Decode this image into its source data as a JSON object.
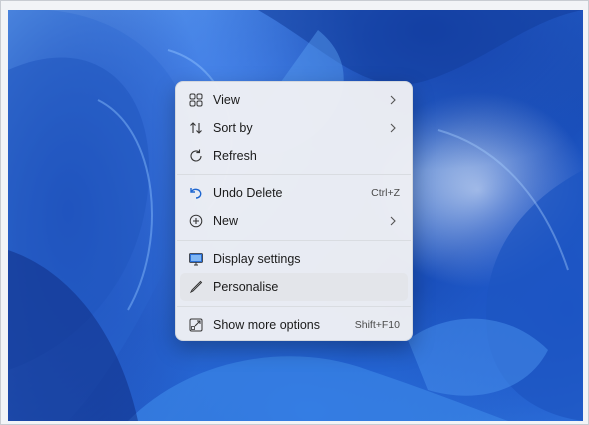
{
  "menu": {
    "items": [
      {
        "label": "View",
        "icon": "grid-icon",
        "submenu": true
      },
      {
        "label": "Sort by",
        "icon": "sort-icon",
        "submenu": true
      },
      {
        "label": "Refresh",
        "icon": "refresh-icon",
        "submenu": false
      },
      {
        "label": "Undo Delete",
        "icon": "undo-icon",
        "shortcut": "Ctrl+Z"
      },
      {
        "label": "New",
        "icon": "plus-circle-icon",
        "submenu": true
      },
      {
        "label": "Display settings",
        "icon": "display-icon"
      },
      {
        "label": "Personalise",
        "icon": "brush-icon",
        "highlighted": true
      },
      {
        "label": "Show more options",
        "icon": "open-external-icon",
        "shortcut": "Shift+F10"
      }
    ]
  },
  "colors": {
    "menu_bg": "#eef0f4",
    "hover_bg": "#e3e5ea",
    "accent": "#1e66d0",
    "wallpaper_deep": "#1a4fb8",
    "wallpaper_light": "#6aa6f0"
  }
}
